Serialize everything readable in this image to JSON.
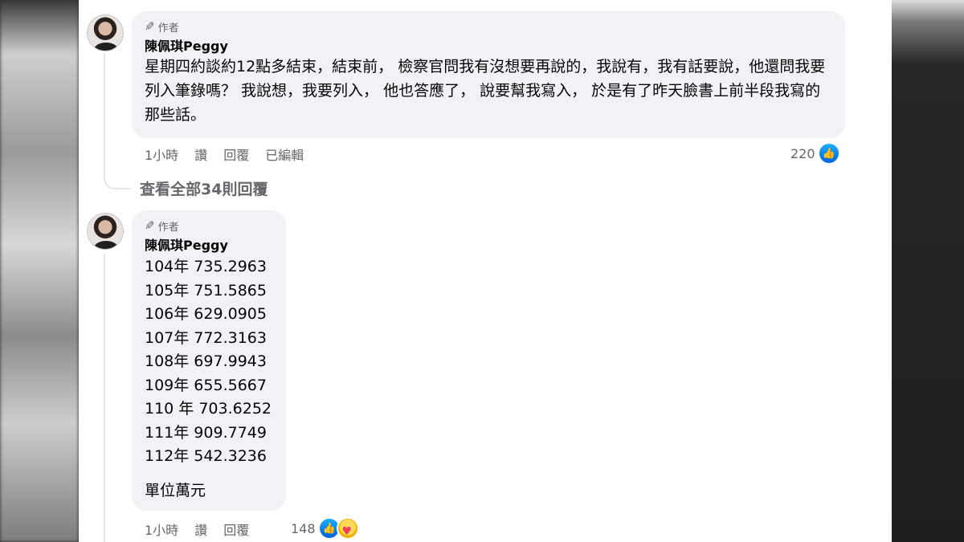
{
  "comments": [
    {
      "badge": "作者",
      "author": "陳佩琪Peggy",
      "text": "星期四約談約12點多結束，結束前， 檢察官問我有沒想要再說的，我說有，我有話要說，他還問我要列入筆錄嗎？ 我說想，我要列入， 他也答應了， 說要幫我寫入， 於是有了昨天臉書上前半段我寫的那些話。",
      "time": "1小時",
      "like": "讚",
      "reply": "回覆",
      "edited": "已編輯",
      "reactions": "220"
    },
    {
      "badge": "作者",
      "author": "陳佩琪Peggy",
      "lines": [
        "104年 735.2963",
        "105年 751.5865",
        "106年 629.0905",
        "107年 772.3163",
        "108年 697.9943",
        "109年 655.5667",
        "110 年 703.6252",
        "111年 909.7749",
        "112年 542.3236"
      ],
      "unit": "單位萬元",
      "time": "1小時",
      "like": "讚",
      "reply": "回覆",
      "reactions": "148"
    }
  ],
  "view_replies": "查看全部34則回覆",
  "icons": {
    "badge": "pencil-icon",
    "reaction_like": "like-reaction-icon",
    "reaction_care": "care-reaction-icon"
  },
  "colors": {
    "like_blue": "#0866ff",
    "bubble_bg": "#f0f2f5",
    "meta_text": "#65676b"
  }
}
